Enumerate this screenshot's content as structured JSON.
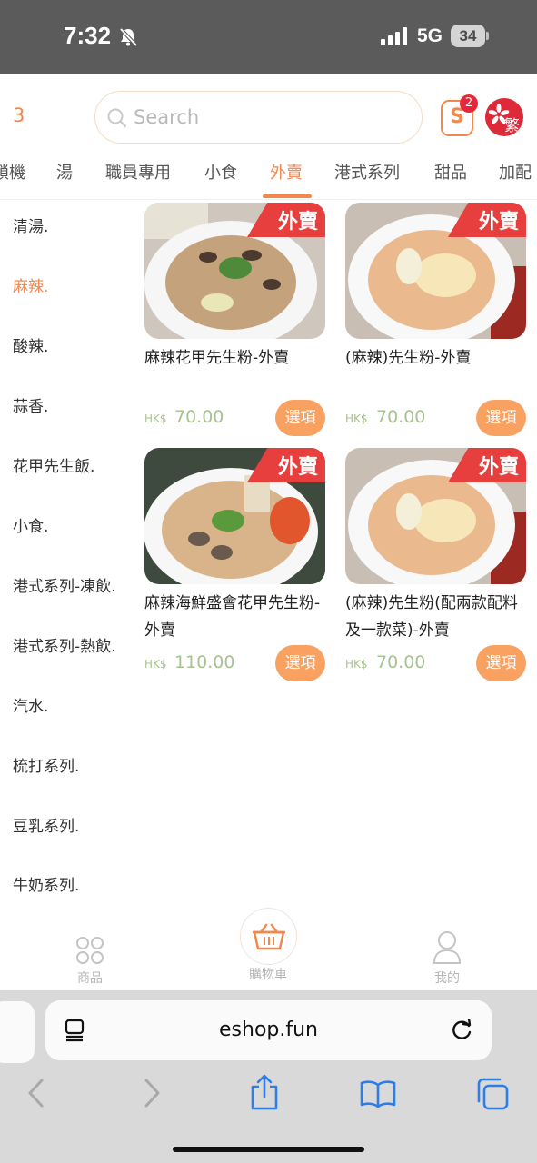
{
  "status_bar": {
    "time": "7:32",
    "network": "5G",
    "battery": "34"
  },
  "header": {
    "count": "3",
    "search_placeholder": "Search",
    "cart_badge": "2",
    "language": "繁"
  },
  "category_tabs": [
    "鎖機",
    "湯",
    "職員專用",
    "小食",
    "外賣",
    "港式系列",
    "甜品",
    "加配"
  ],
  "active_tab": "外賣",
  "sidebar": [
    "清湯.",
    "麻辣.",
    "酸辣.",
    "蒜香.",
    "花甲先生飯.",
    "小食.",
    "港式系列-凍飲.",
    "港式系列-熱飲.",
    "汽水.",
    "梳打系列.",
    "豆乳系列.",
    "牛奶系列."
  ],
  "active_sidebar": "麻辣.",
  "products": [
    {
      "name": "麻辣花甲先生粉-外賣",
      "currency": "HK$",
      "price": "70.00",
      "badge": "外賣",
      "button": "選項"
    },
    {
      "name": "(麻辣)先生粉-外賣",
      "currency": "HK$",
      "price": "70.00",
      "badge": "外賣",
      "button": "選項"
    },
    {
      "name": "麻辣海鮮盛會花甲先生粉-外賣",
      "currency": "HK$",
      "price": "110.00",
      "badge": "外賣",
      "button": "選項"
    },
    {
      "name": "(麻辣)先生粉(配兩款配料及一款菜)-外賣",
      "currency": "HK$",
      "price": "70.00",
      "badge": "外賣",
      "button": "選項"
    }
  ],
  "bottom_nav": {
    "products": "商品",
    "cart": "購物車",
    "mine": "我的"
  },
  "browser": {
    "url": "eshop.fun"
  },
  "colors": {
    "accent": "#f2884e",
    "price": "#a8c191",
    "badge": "#e73e3e",
    "button": "#f8a160"
  }
}
